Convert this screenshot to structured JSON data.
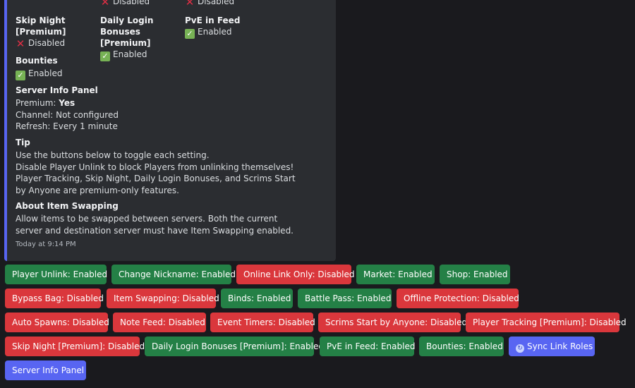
{
  "embed": {
    "top_row": [
      {
        "status": "Disabled",
        "state": "cross"
      },
      {
        "status": "Disabled",
        "state": "cross"
      }
    ],
    "fields": [
      {
        "name_line1": "Skip Night",
        "name_line2": "[Premium]",
        "status": "Disabled",
        "state": "cross"
      },
      {
        "name_line1": "Daily Login Bonuses",
        "name_line2": "[Premium]",
        "status": "Enabled",
        "state": "check"
      },
      {
        "name_line1": "PvE in Feed",
        "name_line2": "",
        "status": "Enabled",
        "state": "check"
      }
    ],
    "bounties": {
      "name": "Bounties",
      "status": "Enabled"
    },
    "server_info": {
      "title": "Server Info Panel",
      "premium_label": "Premium:",
      "premium_value": "Yes",
      "channel": "Channel: Not configured",
      "refresh": "Refresh: Every 1 minute"
    },
    "tip": {
      "title": "Tip",
      "lines": [
        "Use the buttons below to toggle each setting.",
        "Disable Player Unlink to block Players from unlinking themselves!",
        "Player Tracking, Skip Night, Daily Login Bonuses, and Scrims Start",
        "by Anyone are premium-only features."
      ]
    },
    "about": {
      "title": "About Item Swapping",
      "lines": [
        "Allow items to be swapped between servers. Both the current",
        "server and destination server must have Item Swapping enabled."
      ]
    },
    "timestamp": "Today at 9:14 PM"
  },
  "buttons": [
    {
      "label": "Player Unlink: Enabled",
      "color": "green"
    },
    {
      "label": "Change Nickname: Enabled",
      "color": "green"
    },
    {
      "label": "Online Link Only: Disabled",
      "color": "red"
    },
    {
      "label": "Market: Enabled",
      "color": "green"
    },
    {
      "label": "Shop: Enabled",
      "color": "green"
    },
    {
      "label": "Bypass Bag: Disabled",
      "color": "red"
    },
    {
      "label": "Item Swapping: Disabled",
      "color": "red"
    },
    {
      "label": "Binds: Enabled",
      "color": "green"
    },
    {
      "label": "Battle Pass: Enabled",
      "color": "green"
    },
    {
      "label": "Offline Protection: Disabled",
      "color": "red"
    },
    {
      "label": "Auto Spawns: Disabled",
      "color": "red"
    },
    {
      "label": "Note Feed: Disabled",
      "color": "red"
    },
    {
      "label": "Event Timers: Disabled",
      "color": "red"
    },
    {
      "label": "Scrims Start by Anyone: Disabled",
      "color": "red"
    },
    {
      "label": "Player Tracking [Premium]: Disabled",
      "color": "red"
    },
    {
      "label": "Skip Night [Premium]: Disabled",
      "color": "red"
    },
    {
      "label": "Daily Login Bonuses [Premium]: Enabled",
      "color": "green"
    },
    {
      "label": "PvE in Feed: Enabled",
      "color": "green"
    },
    {
      "label": "Bounties: Enabled",
      "color": "green"
    },
    {
      "label": "Sync Link Roles",
      "color": "blurple",
      "icon": "sync-icon"
    },
    {
      "label": "Server Info Panel",
      "color": "blurple"
    }
  ],
  "colors": {
    "green": "#248046",
    "red": "#da373c",
    "blurple": "#5865f2",
    "embed_border": "#5865f2"
  }
}
